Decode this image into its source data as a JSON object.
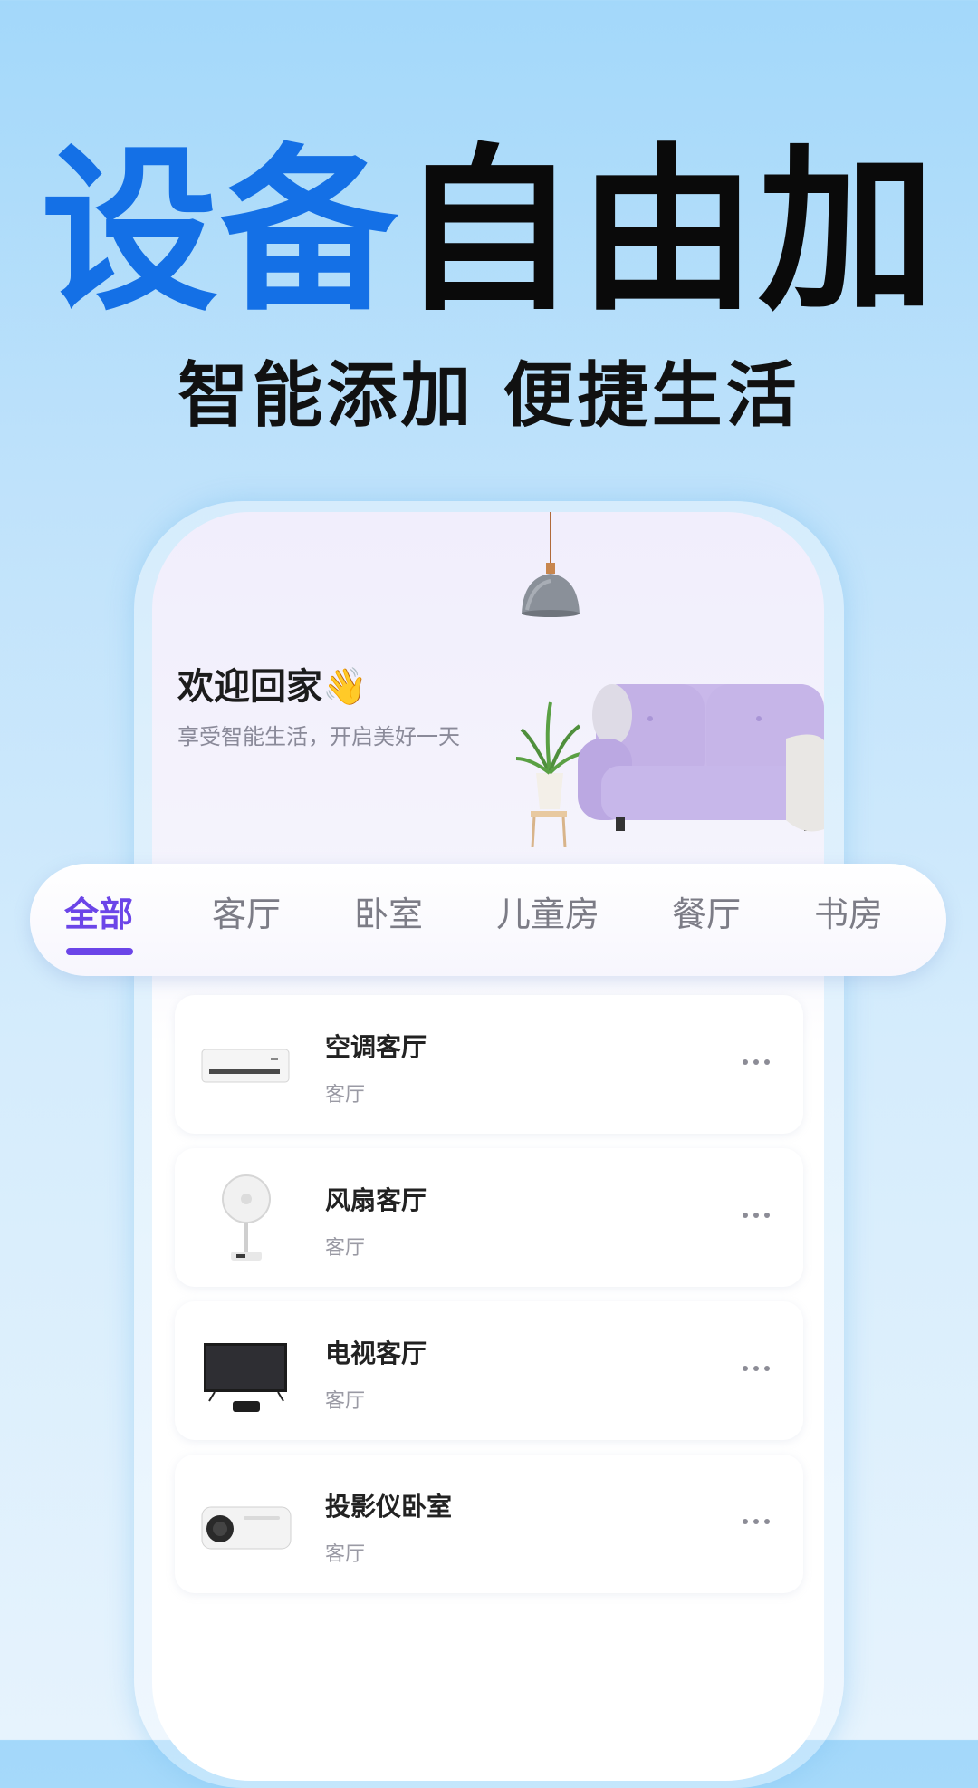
{
  "hero": {
    "title_blue": "设备",
    "title_black": "自由加",
    "subtitle": "智能添加 便捷生活"
  },
  "home": {
    "welcome": "欢迎回家👋",
    "tagline": "享受智能生活，开启美好一天"
  },
  "tabs": [
    {
      "label": "全部",
      "active": true
    },
    {
      "label": "客厅",
      "active": false
    },
    {
      "label": "卧室",
      "active": false
    },
    {
      "label": "儿童房",
      "active": false
    },
    {
      "label": "餐厅",
      "active": false
    },
    {
      "label": "书房",
      "active": false
    }
  ],
  "devices": [
    {
      "name": "空调客厅",
      "room": "客厅",
      "icon": "air-conditioner-icon"
    },
    {
      "name": "风扇客厅",
      "room": "客厅",
      "icon": "fan-icon"
    },
    {
      "name": "电视客厅",
      "room": "客厅",
      "icon": "tv-icon"
    },
    {
      "name": "投影仪卧室",
      "room": "客厅",
      "icon": "projector-icon"
    }
  ],
  "colors": {
    "accent": "#6b45e8",
    "title_blue": "#1470e6",
    "background": "#a3d8fa"
  }
}
